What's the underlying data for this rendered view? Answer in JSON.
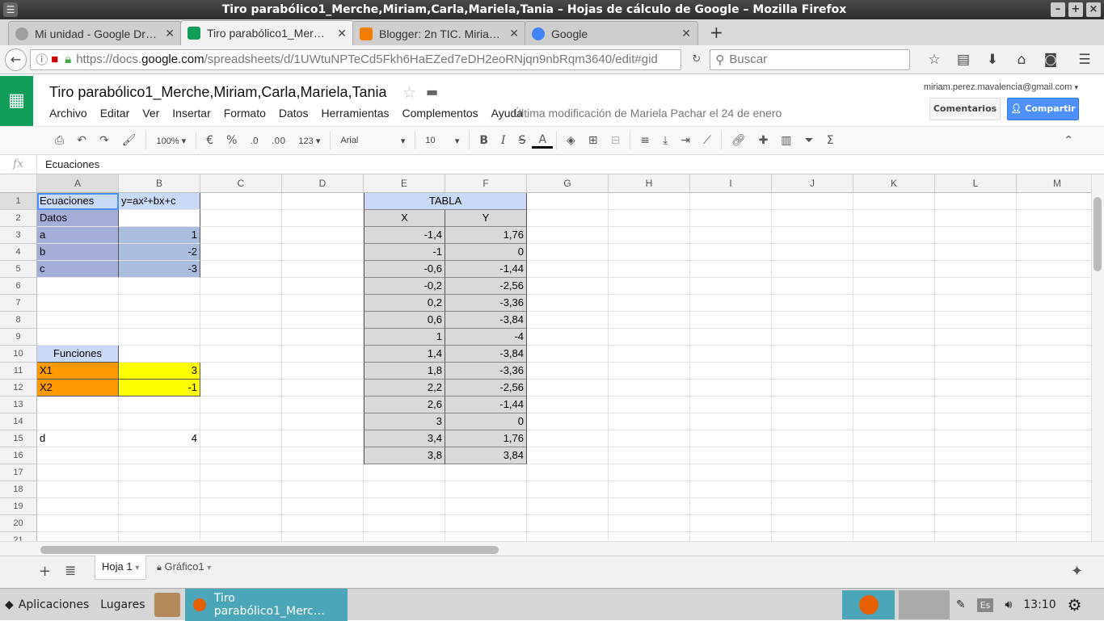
{
  "window": {
    "title": "Tiro parabólico1_Merche,Miriam,Carla,Mariela,Tania – Hojas de cálculo de Google – Mozilla Firefox"
  },
  "tabs": [
    {
      "label": "Mi unidad - Google Dr…",
      "icon": "google-drive-icon",
      "color": "#9e9e9e"
    },
    {
      "label": "Tiro parabólico1_Mer…",
      "icon": "google-sheets-icon",
      "color": "#0f9d58",
      "active": true
    },
    {
      "label": "Blogger: 2n TIC. Miria…",
      "icon": "blogger-icon",
      "color": "#f57d00"
    },
    {
      "label": "Google",
      "icon": "google-icon",
      "color": "#4285f4"
    }
  ],
  "nav": {
    "url_prefix": "https://docs.",
    "url_host": "google.com",
    "url_rest": "/spreadsheets/d/1UWtuNPTeCd5Fkh6HaEZed7eDH2eoRNjqn9nbRqm3640/edit#gid",
    "search_placeholder": "Buscar"
  },
  "doc": {
    "title": "Tiro parabólico1_Merche,Miriam,Carla,Mariela,Tania",
    "menus": [
      "Archivo",
      "Editar",
      "Ver",
      "Insertar",
      "Formato",
      "Datos",
      "Herramientas",
      "Complementos",
      "Ayuda"
    ],
    "last_modified": "Última modificación de Mariela Pachar el 24 de enero",
    "email": "miriam.perez.mavalencia@gmail.com",
    "comments_label": "Comentarios",
    "share_label": "Compartir"
  },
  "toolbar": {
    "zoom": "100%",
    "currency": "€",
    "percent": "%",
    "dec_less": ".0",
    "dec_more": ".00",
    "more_formats": "123",
    "font": "Arial",
    "font_size": "10"
  },
  "formula_bar": {
    "fx": "fx",
    "value": "Ecuaciones"
  },
  "columns": [
    "A",
    "B",
    "C",
    "D",
    "E",
    "F",
    "G",
    "H",
    "I",
    "J",
    "K",
    "L",
    "M"
  ],
  "rows": [
    "1",
    "2",
    "3",
    "4",
    "5",
    "6",
    "7",
    "8",
    "9",
    "10",
    "11",
    "12",
    "13",
    "14",
    "15",
    "16",
    "17",
    "18",
    "19",
    "20",
    "21"
  ],
  "cells": {
    "A1": "Ecuaciones",
    "B1": "y=ax²+bx+c",
    "E1": "TABLA",
    "A2": "Datos",
    "E2": "X",
    "F2": "Y",
    "A3": "a",
    "B3": "1",
    "E3": "-1,4",
    "F3": "1,76",
    "A4": "b",
    "B4": "-2",
    "E4": "-1",
    "F4": "0",
    "A5": "c",
    "B5": "-3",
    "E5": "-0,6",
    "F5": "-1,44",
    "E6": "-0,2",
    "F6": "-2,56",
    "E7": "0,2",
    "F7": "-3,36",
    "E8": "0,6",
    "F8": "-3,84",
    "E9": "1",
    "F9": "-4",
    "A10": "Funciones",
    "E10": "1,4",
    "F10": "-3,84",
    "A11": "X1",
    "B11": "3",
    "E11": "1,8",
    "F11": "-3,36",
    "A12": "X2",
    "B12": "-1",
    "E12": "2,2",
    "F12": "-2,56",
    "E13": "2,6",
    "F13": "-1,44",
    "E14": "3",
    "F14": "0",
    "A15": "d",
    "B15": "4",
    "E15": "3,4",
    "F15": "1,76",
    "E16": "3,8",
    "F16": "3,84"
  },
  "sheets": [
    {
      "label": "Hoja 1",
      "active": true
    },
    {
      "label": "Gráfico1",
      "locked": true
    }
  ],
  "taskbar": {
    "apps_label": "Aplicaciones",
    "places_label": "Lugares",
    "window_label": "Tiro parabólico1_Merc…",
    "keyboard": "Es",
    "clock": "13:10"
  }
}
